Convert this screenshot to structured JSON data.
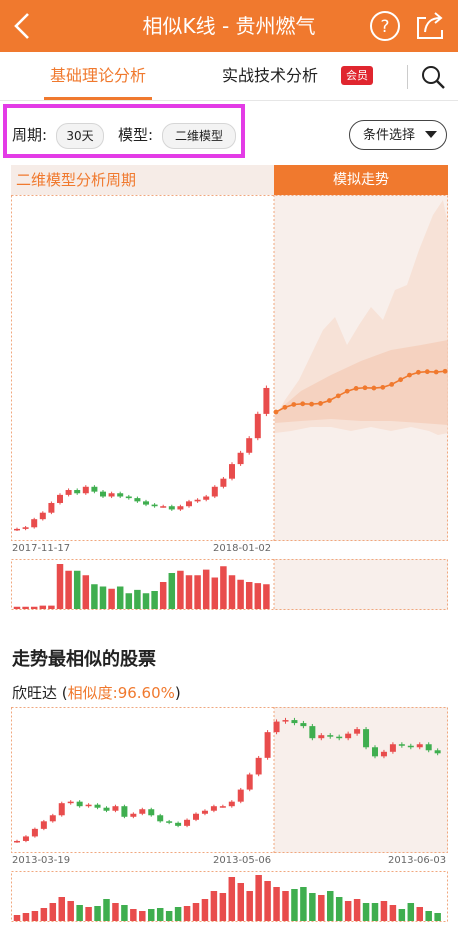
{
  "header": {
    "title": "相似K线 - 贵州燃气",
    "back_icon": "chevron-left-icon",
    "help_icon": "question-circle-icon",
    "share_icon": "share-icon",
    "bar_color": "#f0792e"
  },
  "tabs": [
    {
      "label": "基础理论分析",
      "active": true
    },
    {
      "label": "实战技术分析",
      "badge": "会员"
    }
  ],
  "search_icon": "search-icon",
  "filters": {
    "period_label": "周期:",
    "period_value": "30天",
    "model_label": "模型:",
    "model_value": "二维模型",
    "condition_button": "条件选择"
  },
  "main_chart": {
    "left_header": "二维模型分析周期",
    "right_header": "模拟走势",
    "date_start": "2017-11-17",
    "date_split": "2018-01-02"
  },
  "similar_section": {
    "title": "走势最相似的股票",
    "stock_name": "欣旺达",
    "similarity_prefix": "相似度:",
    "similarity_value": "96.60%",
    "date_start": "2013-03-19",
    "date_split": "2013-05-06",
    "date_end": "2013-06-03"
  },
  "colors": {
    "accent": "#f0792e",
    "up": "#e84c4c",
    "down": "#3fae4f",
    "highlight": "#e33be6",
    "vip_badge": "#e0262f"
  }
}
